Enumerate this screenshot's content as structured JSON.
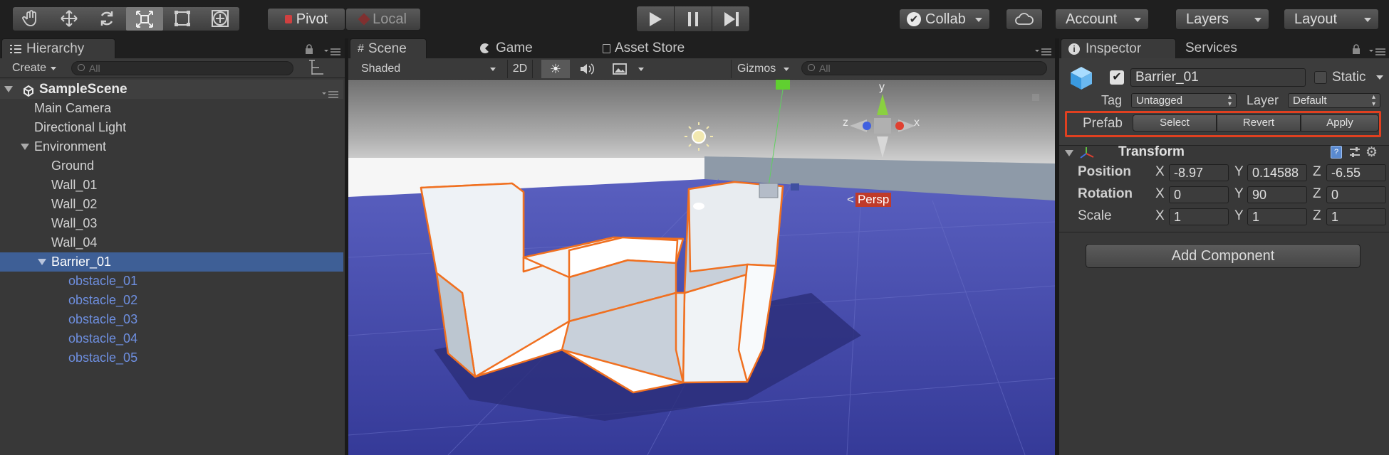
{
  "toolbar": {
    "pivot_label": "Pivot",
    "local_label": "Local",
    "collab_label": "Collab",
    "account_label": "Account",
    "layers_label": "Layers",
    "layout_label": "Layout"
  },
  "hierarchy": {
    "tab_label": "Hierarchy",
    "create_label": "Create",
    "search_placeholder": "All",
    "scene_name": "SampleScene",
    "items": [
      {
        "label": "Main Camera"
      },
      {
        "label": "Directional Light"
      },
      {
        "label": "Environment"
      },
      {
        "label": "Ground"
      },
      {
        "label": "Wall_01"
      },
      {
        "label": "Wall_02"
      },
      {
        "label": "Wall_03"
      },
      {
        "label": "Wall_04"
      },
      {
        "label": "Barrier_01"
      },
      {
        "label": "obstacle_01"
      },
      {
        "label": "obstacle_02"
      },
      {
        "label": "obstacle_03"
      },
      {
        "label": "obstacle_04"
      },
      {
        "label": "obstacle_05"
      }
    ]
  },
  "scene": {
    "tabs": [
      {
        "label": "Scene"
      },
      {
        "label": "Game"
      },
      {
        "label": "Asset Store"
      }
    ],
    "shading_mode": "Shaded",
    "mode_2d": "2D",
    "gizmos_label": "Gizmos",
    "search_placeholder": "All",
    "axis_y": "y",
    "axis_z": "z",
    "axis_x": "x",
    "projection_label": "Persp"
  },
  "inspector": {
    "tabs": [
      {
        "label": "Inspector"
      },
      {
        "label": "Services"
      }
    ],
    "object_name": "Barrier_01",
    "static_label": "Static",
    "tag_label": "Tag",
    "tag_value": "Untagged",
    "layer_label": "Layer",
    "layer_value": "Default",
    "prefab": {
      "label": "Prefab",
      "select_label": "Select",
      "revert_label": "Revert",
      "apply_label": "Apply"
    },
    "transform": {
      "title": "Transform",
      "position": {
        "label": "Position",
        "x": "-8.97",
        "y": "0.14588",
        "z": "-6.55"
      },
      "rotation": {
        "label": "Rotation",
        "x": "0",
        "y": "90",
        "z": "0"
      },
      "scale": {
        "label": "Scale",
        "x": "1",
        "y": "1",
        "z": "1"
      },
      "axis_x": "X",
      "axis_y": "Y",
      "axis_z": "Z"
    },
    "add_component_label": "Add Component"
  },
  "colors": {
    "selection": "#3e5f96",
    "prefab_text": "#6e8fe0",
    "highlight_box": "#e04020",
    "selection_outline": "#f07020",
    "ground": "#3b3f9a"
  }
}
